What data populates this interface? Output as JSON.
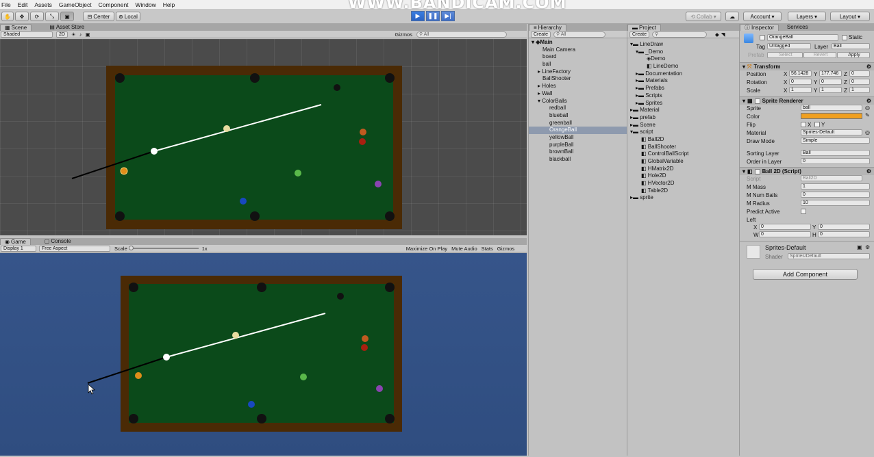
{
  "menubar": {
    "items": [
      "File",
      "Edit",
      "Assets",
      "GameObject",
      "Component",
      "Window",
      "Help"
    ]
  },
  "watermark": "WWW.BANDICAM.COM",
  "toolbar": {
    "pivot": "Center",
    "space": "Local",
    "collab": "Collab",
    "account": "Account",
    "layers": "Layers",
    "layout": "Layout"
  },
  "scene": {
    "tab": "Scene",
    "tab2": "Asset Store",
    "shading": "Shaded",
    "mode2d": "2D",
    "gizmos": "Gizmos",
    "search": "All"
  },
  "game": {
    "tab": "Game",
    "tab2": "Console",
    "display": "Display 1",
    "aspect": "Free Aspect",
    "scale_label": "Scale",
    "scale_value": "1x",
    "maximize": "Maximize On Play",
    "mute": "Mute Audio",
    "stats": "Stats",
    "gizmos": "Gizmos"
  },
  "hierarchy": {
    "title": "Hierarchy",
    "create": "Create",
    "search": "All",
    "scene": "Main",
    "items": [
      "Main Camera",
      "board",
      "ball",
      "LineFactory",
      "BallShooter",
      "Holes",
      "Wall",
      "ColorBalls",
      "redball",
      "blueball",
      "greenball",
      "OrangeBall",
      "yellowBall",
      "purpleBall",
      "brownBall",
      "blackball"
    ]
  },
  "project": {
    "title": "Project",
    "create": "Create",
    "items": [
      "LineDraw",
      "_Demo",
      "Demo",
      "LineDemo",
      "Documentation",
      "Materials",
      "Prefabs",
      "Scripts",
      "Sprites",
      "Material",
      "prefab",
      "Scene",
      "script",
      "Ball2D",
      "BallShooter",
      "ControlBallScript",
      "GlobalVariable",
      "HMatrix2D",
      "Hole2D",
      "HVector2D",
      "Table2D",
      "sprite"
    ]
  },
  "inspector": {
    "title": "Inspector",
    "services": "Services",
    "name": "OrangeBall",
    "static": "Static",
    "tag_label": "Tag",
    "tag": "Untagged",
    "layer_label": "Layer",
    "layer": "Ball",
    "prefab": "Prefab",
    "select": "Select",
    "revert": "Revert",
    "apply": "Apply",
    "transform": {
      "title": "Transform",
      "position_label": "Position",
      "rotation_label": "Rotation",
      "scale_label": "Scale",
      "pos": [
        "56.1428",
        "177.746",
        "0"
      ],
      "rot": [
        "0",
        "0",
        "0"
      ],
      "scl": [
        "1",
        "1",
        "1"
      ]
    },
    "sprite_renderer": {
      "title": "Sprite Renderer",
      "sprite_label": "Sprite",
      "sprite": "ball",
      "color_label": "Color",
      "color": "#f0a020",
      "flip_label": "Flip",
      "flip_x": "X",
      "flip_y": "Y",
      "material_label": "Material",
      "material": "Sprites-Default",
      "drawmode_label": "Draw Mode",
      "drawmode": "Simple",
      "sorting_label": "Sorting Layer",
      "sorting": "Ball",
      "order_label": "Order in Layer",
      "order": "0"
    },
    "ball2d": {
      "title": "Ball 2D (Script)",
      "script_label": "Script",
      "script": "Ball2D",
      "mass_label": "M Mass",
      "mass": "1",
      "numballs_label": "M Num Balls",
      "numballs": "0",
      "radius_label": "M Radius",
      "radius": "10",
      "predict_label": "Predict Active",
      "left_label": "Left",
      "left_x": "0",
      "left_y": "0",
      "left_w": "0",
      "left_h": "0",
      "x": "X",
      "y": "Y",
      "w": "W",
      "h": "H"
    },
    "material": {
      "name": "Sprites-Default",
      "shader_label": "Shader",
      "shader": "Sprites/Default"
    },
    "add_component": "Add Component"
  },
  "colors": {
    "felt": "#0b4a1a",
    "rail": "#4a2a05",
    "orange": "#e08e1a",
    "yellow": "#e8dca0",
    "red": "#a82010",
    "green": "#5ab84a",
    "blue": "#1848c0",
    "purple": "#8a44b0",
    "brown": "#c05a20",
    "black": "#111111",
    "white": "#ffffff"
  }
}
